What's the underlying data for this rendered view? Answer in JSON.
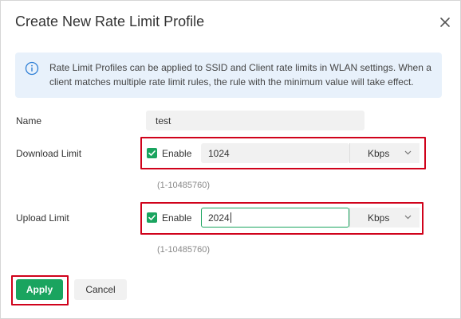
{
  "dialog": {
    "title": "Create New Rate Limit Profile",
    "close_icon": "close-icon"
  },
  "info": {
    "icon": "info-circle-icon",
    "text": "Rate Limit Profiles can be applied to SSID and Client rate limits in WLAN settings. When a client matches multiple rate limit rules, the rule with the minimum value will take effect."
  },
  "form": {
    "name": {
      "label": "Name",
      "value": "test"
    },
    "download": {
      "label": "Download Limit",
      "enable_label": "Enable",
      "enabled": true,
      "value": "1024",
      "unit": "Kbps",
      "hint": "(1-10485760)"
    },
    "upload": {
      "label": "Upload Limit",
      "enable_label": "Enable",
      "enabled": true,
      "value": "2024",
      "unit": "Kbps",
      "hint": "(1-10485760)"
    }
  },
  "actions": {
    "apply_label": "Apply",
    "cancel_label": "Cancel"
  },
  "colors": {
    "accent": "#1aa45f",
    "highlight": "#d0021b",
    "info_bg": "#e8f1fb",
    "info_icon": "#2f7fd6"
  }
}
